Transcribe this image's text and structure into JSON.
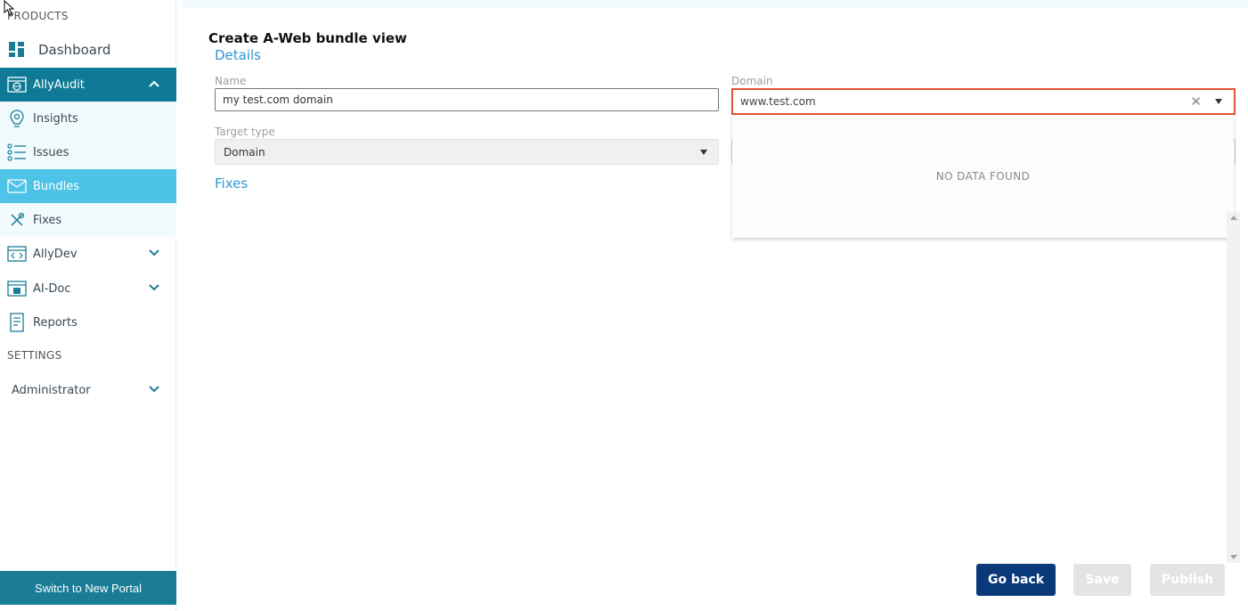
{
  "sidebar": {
    "products_label": "PRODUCTS",
    "settings_label": "SETTINGS",
    "items": {
      "dashboard": "Dashboard",
      "allyaudit": "AllyAudit",
      "insights": "Insights",
      "issues": "Issues",
      "bundles": "Bundles",
      "fixes": "Fixes",
      "allydev": "AllyDev",
      "aidoc": "AI-Doc",
      "reports": "Reports",
      "administrator": "Administrator"
    },
    "switch_label": "Switch to New Portal"
  },
  "main": {
    "title": "Create A-Web bundle view",
    "details_label": "Details",
    "fixes_label": "Fixes",
    "name_label": "Name",
    "name_value": "my test.com domain",
    "target_type_label": "Target type",
    "target_type_value": "Domain",
    "domain_label": "Domain",
    "domain_value": "www.test.com",
    "dropdown_empty": "NO DATA FOUND"
  },
  "buttons": {
    "go_back": "Go back",
    "save": "Save",
    "publish": "Publish"
  },
  "colors": {
    "primary": "#0a3a7a",
    "sidebar_active": "#4ec3e8",
    "sidebar_group": "#0e7a96",
    "link": "#2e95d3",
    "error_border": "#e0562f"
  }
}
